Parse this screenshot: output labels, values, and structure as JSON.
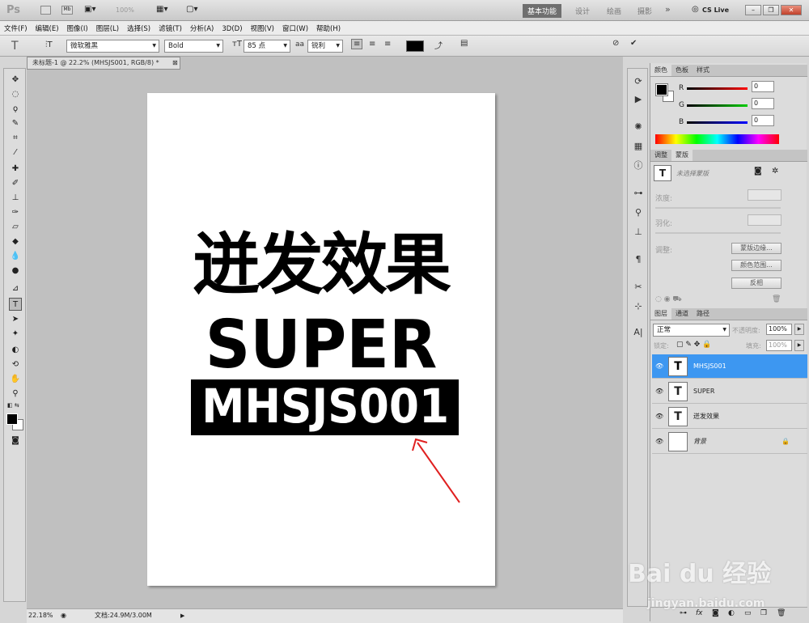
{
  "app": {
    "logo": "Ps",
    "zoom_select": "100%"
  },
  "workspace": {
    "items": [
      "基本功能",
      "设计",
      "绘画",
      "摄影"
    ],
    "more": "»",
    "cslive": "CS Live"
  },
  "menu": [
    "文件(F)",
    "编辑(E)",
    "图像(I)",
    "图层(L)",
    "选择(S)",
    "滤镜(T)",
    "分析(A)",
    "3D(D)",
    "视图(V)",
    "窗口(W)",
    "帮助(H)"
  ],
  "options": {
    "tool_icon": "T",
    "font_family": "微软雅黑",
    "font_style": "Bold",
    "font_size": "85 点",
    "aa_label": "aa",
    "antialias": "锐利",
    "text_color": "#000000"
  },
  "document": {
    "tab_title": "未标题-1 @ 22.2% (MHSJS001, RGB/8) *",
    "line1": "迸发效果",
    "line2": "SUPER",
    "line3": "MHSJS001"
  },
  "status": {
    "zoom": "22.18%",
    "doc_info": "文档:24.9M/3.00M"
  },
  "color_panel": {
    "tabs": [
      "颜色",
      "色板",
      "样式"
    ],
    "channels": [
      {
        "label": "R",
        "value": "0"
      },
      {
        "label": "G",
        "value": "0"
      },
      {
        "label": "B",
        "value": "0"
      }
    ]
  },
  "masks_panel": {
    "tabs": [
      "调整",
      "蒙版"
    ],
    "no_mask": "未选择蒙版",
    "density": "浓度:",
    "feather": "羽化:",
    "refine": "调整:",
    "buttons": [
      "蒙版边缘...",
      "颜色范围...",
      "反相"
    ]
  },
  "layers_panel": {
    "tabs": [
      "图层",
      "通道",
      "路径"
    ],
    "blend_mode": "正常",
    "opacity_label": "不透明度:",
    "opacity": "100%",
    "lock_label": "锁定:",
    "fill_label": "填充:",
    "fill": "100%",
    "layers": [
      {
        "name": "MHSJS001",
        "type": "T",
        "selected": true
      },
      {
        "name": "SUPER",
        "type": "T",
        "selected": false
      },
      {
        "name": "迸发效果",
        "type": "T",
        "selected": false
      },
      {
        "name": "背景",
        "type": "",
        "selected": false
      }
    ]
  },
  "watermark": {
    "brand": "Bai du 经验",
    "url": "jingyan.baidu.com"
  }
}
